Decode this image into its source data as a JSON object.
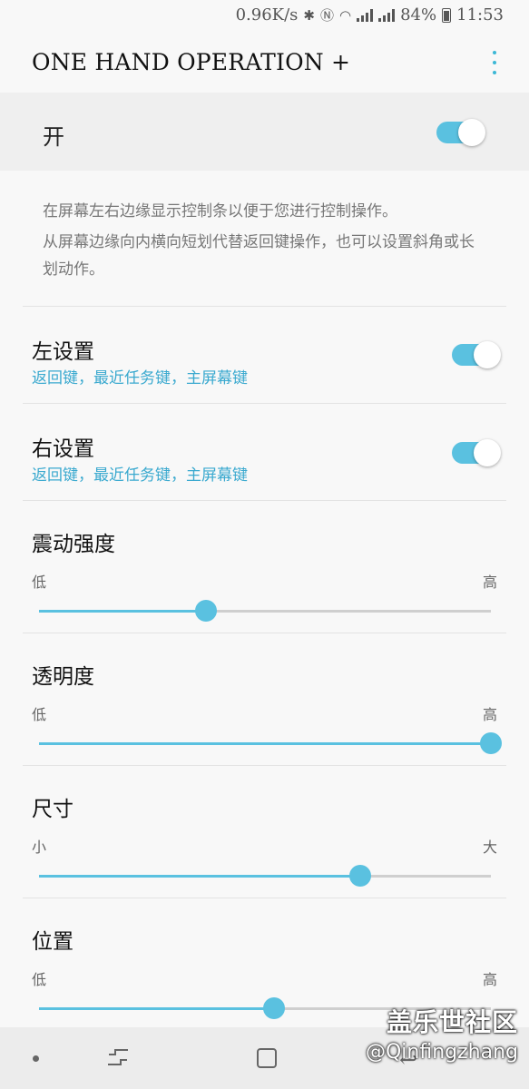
{
  "status_bar": {
    "speed": "0.96K/s",
    "battery": "84%",
    "time": "11:53",
    "icons": [
      "bluetooth-icon",
      "nfc-icon",
      "wifi-icon",
      "4g-signal-icon",
      "2g-signal-icon",
      "battery-icon"
    ]
  },
  "appbar": {
    "title": "ONE HAND OPERATION +",
    "more_icon": "more-vert-icon"
  },
  "master": {
    "label": "开",
    "on": true
  },
  "description": {
    "line1": "在屏幕左右边缘显示控制条以便于您进行控制操作。",
    "line2": "从屏幕边缘向内横向短划代替返回键操作，也可以设置斜角或长划动作。"
  },
  "left_setting": {
    "title": "左设置",
    "subtitle": "返回键，最近任务键，主屏幕键",
    "on": true
  },
  "right_setting": {
    "title": "右设置",
    "subtitle": "返回键，最近任务键，主屏幕键",
    "on": true
  },
  "sliders": [
    {
      "title": "震动强度",
      "low": "低",
      "high": "高",
      "value": 0.37
    },
    {
      "title": "透明度",
      "low": "低",
      "high": "高",
      "value": 1.0
    },
    {
      "title": "尺寸",
      "low": "小",
      "high": "大",
      "value": 0.71
    },
    {
      "title": "位置",
      "low": "低",
      "high": "高",
      "value": 0.52
    }
  ],
  "watermark": {
    "line1": "盖乐世社区",
    "line2": "@Qinfingzhang"
  },
  "colors": {
    "accent": "#5ac1e0",
    "subtitle": "#3aa9cf"
  }
}
